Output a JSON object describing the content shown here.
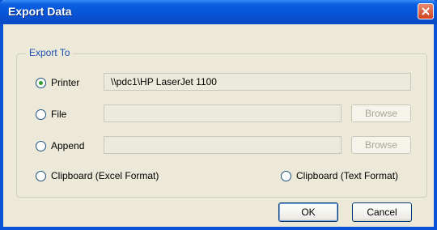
{
  "window": {
    "title": "Export Data"
  },
  "group": {
    "label": "Export To"
  },
  "options": {
    "printer": {
      "label": "Printer",
      "value": "\\\\pdc1\\HP LaserJet 1100"
    },
    "file": {
      "label": "File",
      "value": "",
      "browse_label": "Browse"
    },
    "append": {
      "label": "Append",
      "value": "",
      "browse_label": "Browse"
    },
    "clipboard_excel": {
      "label": "Clipboard (Excel Format)"
    },
    "clipboard_text": {
      "label": "Clipboard (Text Format)"
    }
  },
  "selected_option": "printer",
  "buttons": {
    "ok": "OK",
    "cancel": "Cancel"
  },
  "colors": {
    "titlebar": "#0754d6",
    "close": "#d0411e",
    "group_label": "#1f4fb4"
  }
}
